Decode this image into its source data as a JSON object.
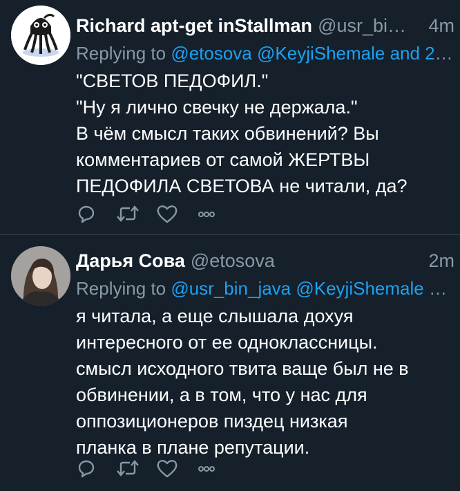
{
  "colors": {
    "background": "#15202b",
    "text": "#ffffff",
    "muted": "#8899a6",
    "link": "#1da1f2",
    "divider": "#38444d"
  },
  "tweets": [
    {
      "author_name": "Richard apt-get inStallman",
      "handle": "@usr_bi…",
      "time": "4m",
      "replying_prefix": "Replying to ",
      "replying_mentions": "@etosova @KeyjiShemale and 2 o…",
      "body": "\"СВЕТОВ ПЕДОФИЛ.\"\n\"Ну я лично свечку не держала.\"\nВ чём смысл таких обвинений? Вы\nкомментариев от самой ЖЕРТВЫ\nПЕДОФИЛА СВЕТОВА не читали, да?",
      "avatar_icon": "octopus-mascot-icon",
      "actions": [
        "reply-icon",
        "retweet-icon",
        "like-icon",
        "more-icon"
      ]
    },
    {
      "author_name": "Дарья Сова",
      "handle": "@etosova",
      "time": "2m",
      "replying_prefix": "Replying to ",
      "replying_mentions": "@usr_bin_java @KeyjiShemale and…",
      "body": "я читала, а еще слышала дохуя\nинтересного от ее одноклассницы.\nсмысл исходного твита ваще был не в\nобвинении, а в том, что у нас для\nоппозиционеров пиздец низкая\nпланка в плане репутации.",
      "avatar_icon": "profile-photo",
      "actions": [
        "reply-icon",
        "retweet-icon",
        "like-icon",
        "more-icon"
      ]
    }
  ]
}
